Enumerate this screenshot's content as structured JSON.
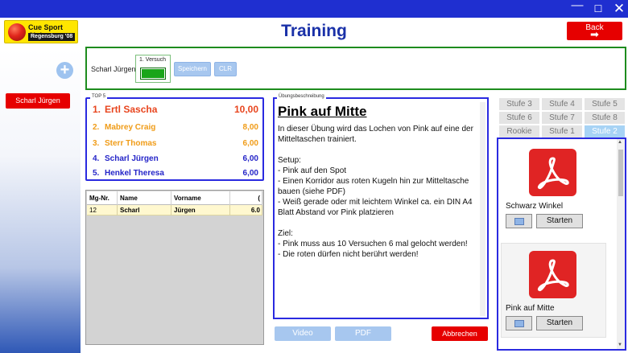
{
  "window": {
    "title": "Training",
    "minimize": "—",
    "maximize": "☐",
    "close": "✕"
  },
  "logo": {
    "line1": "Cue Sport Club",
    "line2": "Regensburg '08"
  },
  "header": {
    "back_label": "Back",
    "back_arrow": "➡"
  },
  "sidebar": {
    "add_symbol": "+",
    "player": "Scharl Jürgen"
  },
  "entry": {
    "player_name": "Scharl Jürgen",
    "try_label": "1. Versuch",
    "save_label": "Speichern",
    "clear_label": "CLR"
  },
  "top5": {
    "title": "TOP 5",
    "rows": [
      {
        "rank": "1.",
        "name": "Ertl Sascha",
        "score": "10,00",
        "color": "#e8451e"
      },
      {
        "rank": "2.",
        "name": "Mabrey Craig",
        "score": "8,00",
        "color": "#f09c18"
      },
      {
        "rank": "3.",
        "name": "Sterr Thomas",
        "score": "6,00",
        "color": "#f09c18"
      },
      {
        "rank": "4.",
        "name": "Scharl Jürgen",
        "score": "6,00",
        "color": "#2424c8"
      },
      {
        "rank": "5.",
        "name": "Henkel Theresa",
        "score": "6,00",
        "color": "#2424c8"
      }
    ]
  },
  "grid": {
    "headers": [
      "Mg-Nr.",
      "Name",
      "Vorname",
      "("
    ],
    "rows": [
      {
        "nr": "12",
        "name": "Scharl",
        "vorname": "Jürgen",
        "value": "6.0"
      }
    ]
  },
  "description": {
    "group_label": "Übungsbeschreibung",
    "title": "Pink auf Mitte",
    "intro": "In dieser Übung wird das Lochen von Pink auf eine der Mitteltaschen trainiert.",
    "setup_heading": "Setup:",
    "setup": [
      "- Pink auf den Spot",
      "- Einen Korridor aus roten Kugeln hin zur Mitteltasche bauen (siehe PDF)",
      "- Weiß gerade oder mit leichtem Winkel ca. ein DIN A4 Blatt Abstand vor Pink platzieren"
    ],
    "goal_heading": "Ziel:",
    "goal": [
      "- Pink muss aus 10 Versuchen 6 mal gelocht werden!",
      "- Die roten dürfen nicht berührt werden!"
    ]
  },
  "actions": {
    "video": "Video",
    "pdf": "PDF",
    "cancel": "Abbrechen"
  },
  "levels": {
    "tabs": [
      "Stufe 3",
      "Stufe 4",
      "Stufe 5",
      "Stufe 6",
      "Stufe 7",
      "Stufe 8",
      "Rookie",
      "Stufe 1",
      "Stufe 2"
    ],
    "active": "Stufe 2"
  },
  "exercises": [
    {
      "name": "Schwarz Winkel",
      "start": "Starten"
    },
    {
      "name": "Pink auf Mitte",
      "start": "Starten"
    }
  ],
  "colors": {
    "accent_red": "#e60000",
    "title_blue": "#1a31a8",
    "panel_blue": "#2a2ae0",
    "panel_green": "#1e8c1e",
    "titlebar": "#1f2fd0"
  }
}
